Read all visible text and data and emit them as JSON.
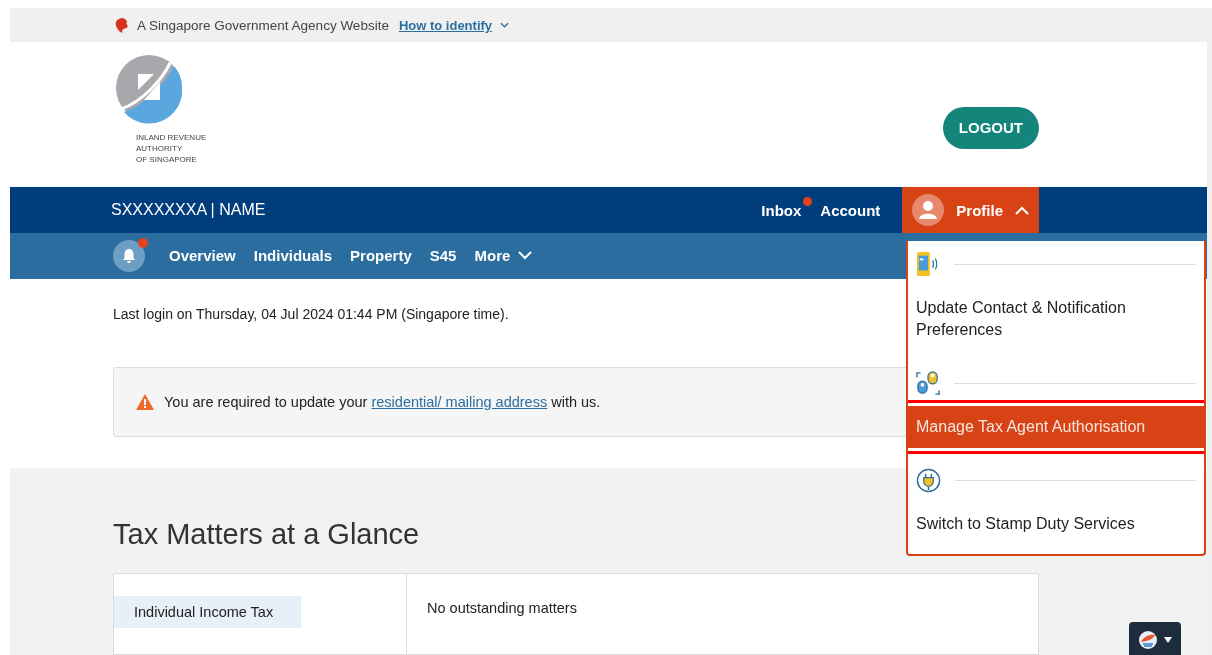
{
  "gov_banner": {
    "text": "A Singapore Government Agency Website",
    "link": "How to identify"
  },
  "logo": {
    "lines": [
      "INLAND REVENUE",
      "AUTHORITY",
      "OF SINGAPORE"
    ]
  },
  "logout_button": "LOGOUT",
  "user_bar": {
    "user": "SXXXXXXXA | NAME",
    "links": [
      {
        "label": "Inbox",
        "badge": true
      },
      {
        "label": "Account",
        "badge": false
      }
    ],
    "profile": {
      "label": "Profile",
      "expanded": true
    }
  },
  "nav": {
    "bell_badge": true,
    "items": [
      {
        "label": "Overview",
        "has_caret": false
      },
      {
        "label": "Individuals",
        "has_caret": false
      },
      {
        "label": "Property",
        "has_caret": false
      },
      {
        "label": "S45",
        "has_caret": false
      },
      {
        "label": "More",
        "has_caret": true
      }
    ]
  },
  "profile_menu": [
    {
      "kind": "contact",
      "label": "Update Contact & Notification Preferences",
      "selected": false,
      "annotated": false
    },
    {
      "kind": "agent",
      "label": "Manage Tax Agent Authorisation",
      "selected": true,
      "annotated": true
    },
    {
      "kind": "switch",
      "label": "Switch to Stamp Duty Services",
      "selected": false,
      "annotated": false
    }
  ],
  "last_login": "Last login on Thursday, 04 Jul 2024 01:44 PM (Singapore time).",
  "alert": {
    "before": "You are required to update your",
    "link": "residential/ mailing address",
    "after": "with us."
  },
  "section_title": "Tax Matters at a Glance",
  "tax_card": {
    "tabs": [
      {
        "label": "Individual Income Tax",
        "selected": true
      }
    ],
    "message": "No outstanding matters"
  }
}
